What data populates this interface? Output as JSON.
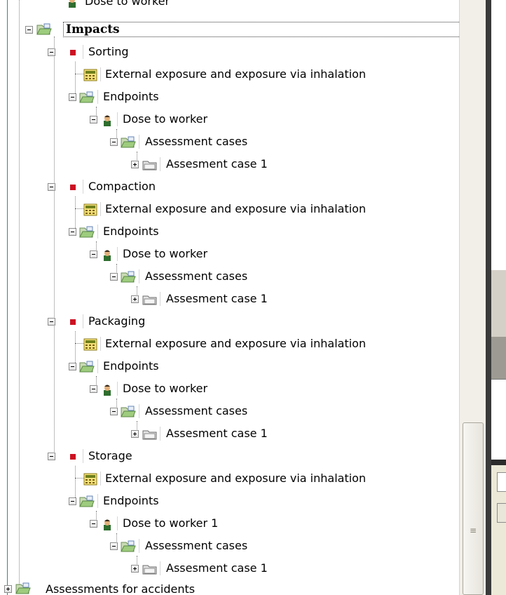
{
  "tree": {
    "partial_top": "Dose to worker",
    "impacts_label": "Impacts",
    "bottom_partial": "Assessments for accidents",
    "groups": [
      {
        "name": "Sorting",
        "exposure": "External exposure and exposure via inhalation",
        "endpoints": "Endpoints",
        "dose": "Dose to worker",
        "assessment_cases": "Assessment cases",
        "case": "Assesment case 1"
      },
      {
        "name": "Compaction",
        "exposure": "External exposure and exposure via inhalation",
        "endpoints": "Endpoints",
        "dose": "Dose to worker",
        "assessment_cases": "Assessment cases",
        "case": "Assesment case 1"
      },
      {
        "name": "Packaging",
        "exposure": "External exposure and exposure via inhalation",
        "endpoints": "Endpoints",
        "dose": "Dose to worker",
        "assessment_cases": "Assessment cases",
        "case": "Assesment case 1"
      },
      {
        "name": "Storage",
        "exposure": "External exposure and exposure via inhalation",
        "endpoints": "Endpoints",
        "dose": "Dose to worker 1",
        "assessment_cases": "Assessment cases",
        "case": "Assesment case 1"
      }
    ]
  },
  "scrollbar": {
    "grip": "≡"
  },
  "colors": {
    "accent": "#2f8c7c",
    "impact_marker": "#cc1122",
    "pane": "#ece9d8"
  }
}
